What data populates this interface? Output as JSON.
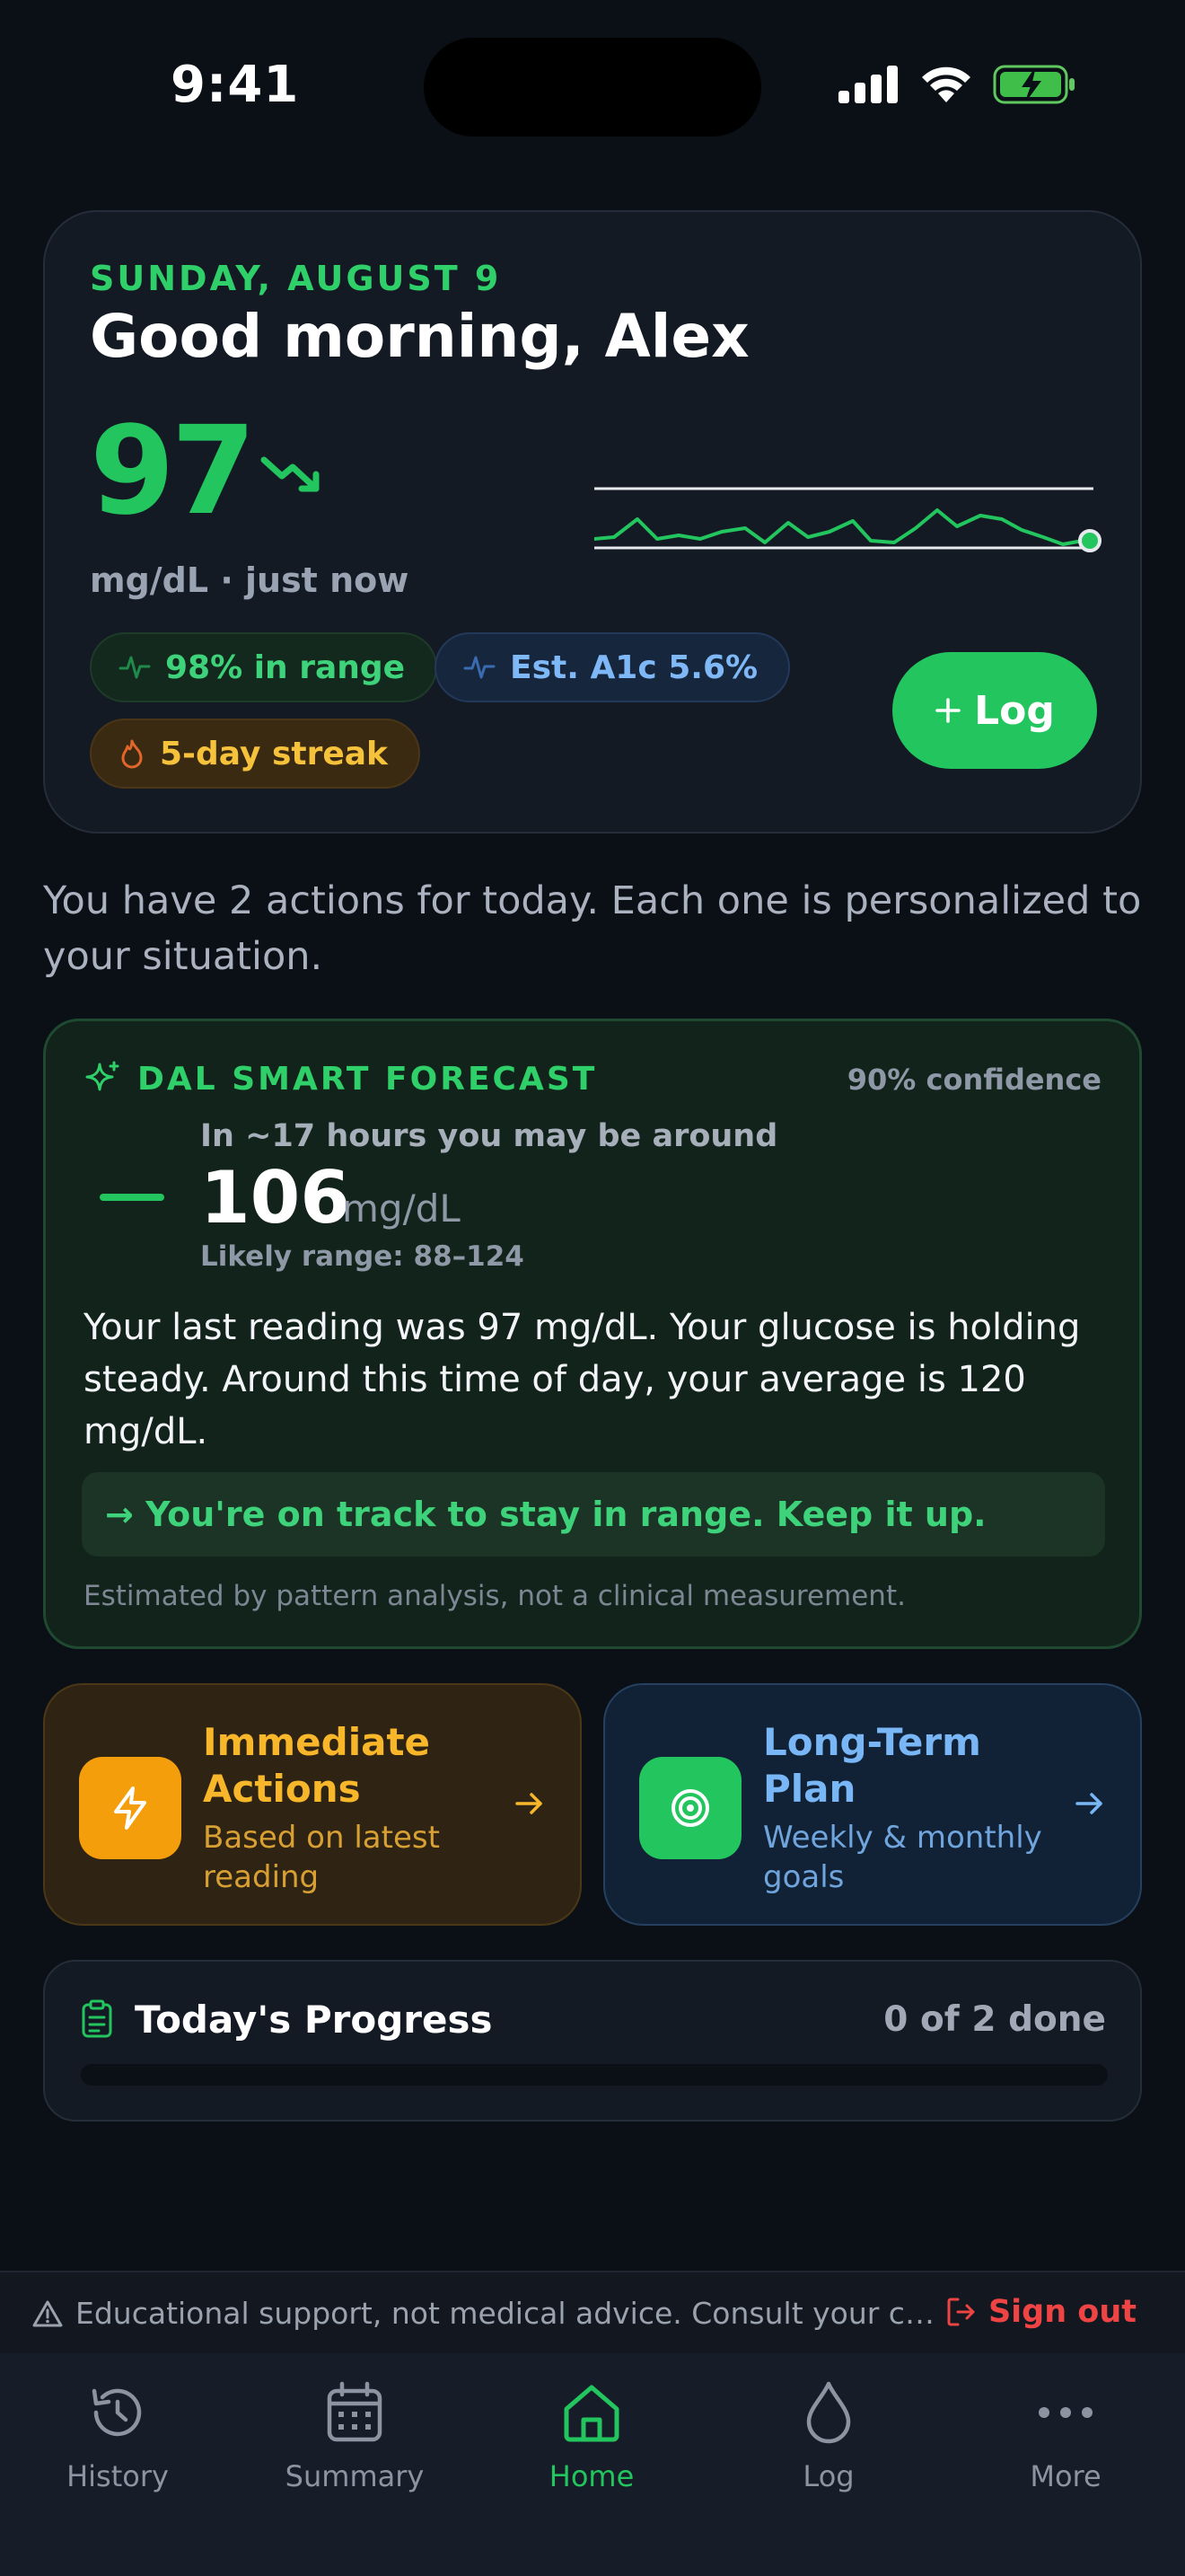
{
  "status": {
    "time": "9:41"
  },
  "hero": {
    "date": "SUNDAY, AUGUST 9",
    "greeting": "Good morning, Alex",
    "glucose_value": "97",
    "unit_time": "mg/dL · just now",
    "trend_icon": "trend-down-icon",
    "chips": {
      "range": "98% in range",
      "a1c": "Est. A1c 5.6%",
      "streak": "5-day streak"
    },
    "log_label": "Log"
  },
  "intro_text": "You have 2 actions for today. Each one is personalized to your situation.",
  "forecast": {
    "title": "DAL SMART FORECAST",
    "confidence": "90% confidence",
    "subtitle": "In ~17 hours you may be around",
    "value": "106",
    "unit": "mg/dL",
    "range": "Likely range: 88–124",
    "body": "Your last reading was 97 mg/dL. Your glucose is holding steady. Around this time of day, your average is 120 mg/dL.",
    "callout": "→ You're on track to stay in range. Keep it up.",
    "note": "Estimated by pattern analysis, not a clinical measurement."
  },
  "actions": {
    "immediate": {
      "title": "Immediate Actions",
      "subtitle": "Based on latest reading"
    },
    "long_term": {
      "title": "Long-Term Plan",
      "subtitle": "Weekly & monthly goals"
    }
  },
  "progress": {
    "title": "Today's Progress",
    "count": "0 of 2 done",
    "done": 0,
    "total": 2
  },
  "disclaimer": {
    "text": "Educational support, not medical advice. Consult your care team.",
    "sign_out": "Sign out"
  },
  "tabs": [
    {
      "label": "History",
      "icon": "history-icon"
    },
    {
      "label": "Summary",
      "icon": "calendar-icon"
    },
    {
      "label": "Home",
      "icon": "home-icon",
      "active": true
    },
    {
      "label": "Log",
      "icon": "droplet-icon"
    },
    {
      "label": "More",
      "icon": "more-icon"
    }
  ],
  "colors": {
    "accent_green": "#22c55e",
    "amber": "#f59e0b",
    "blue": "#78b6f5",
    "danger": "#ef4444"
  }
}
